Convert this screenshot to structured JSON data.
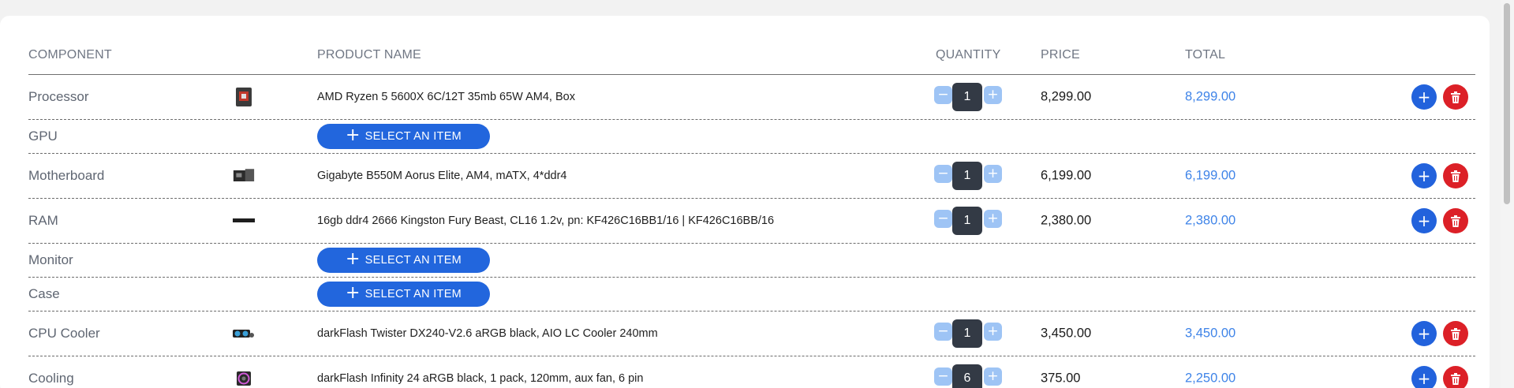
{
  "headers": {
    "component": "COMPONENT",
    "product_name": "PRODUCT NAME",
    "quantity": "QUANTITY",
    "price": "PRICE",
    "total": "TOTAL"
  },
  "select_label": "SELECT AN ITEM",
  "icons": {
    "minus": "minus-icon",
    "plus": "plus-icon",
    "add": "plus-icon",
    "delete": "trash-icon"
  },
  "colors": {
    "accent_blue": "#2262dc",
    "total_blue": "#3f84e8",
    "delete_red": "#dc2027",
    "qty_dark": "#333a45",
    "qty_button": "#9ec4f5"
  },
  "rows": [
    {
      "component": "Processor",
      "product": "AMD Ryzen 5 5600X 6C/12T 35mb 65W AM4, Box",
      "qty": "1",
      "price": "8,299.00",
      "total": "8,299.00"
    },
    {
      "component": "GPU"
    },
    {
      "component": "Motherboard",
      "product": "Gigabyte B550M Aorus Elite, AM4, mATX, 4*ddr4",
      "qty": "1",
      "price": "6,199.00",
      "total": "6,199.00"
    },
    {
      "component": "RAM",
      "product": "16gb ddr4 2666 Kingston Fury Beast, CL16 1.2v, pn: KF426C16BB1/16 | KF426C16BB/16",
      "qty": "1",
      "price": "2,380.00",
      "total": "2,380.00"
    },
    {
      "component": "Monitor"
    },
    {
      "component": "Case"
    },
    {
      "component": "CPU Cooler",
      "product": "darkFlash Twister DX240-V2.6 aRGB black, AIO LC Cooler 240mm",
      "qty": "1",
      "price": "3,450.00",
      "total": "3,450.00"
    },
    {
      "component": "Cooling",
      "product": "darkFlash Infinity 24 aRGB black, 1 pack, 120mm, aux fan, 6 pin",
      "qty": "6",
      "price": "375.00",
      "total": "2,250.00"
    }
  ]
}
